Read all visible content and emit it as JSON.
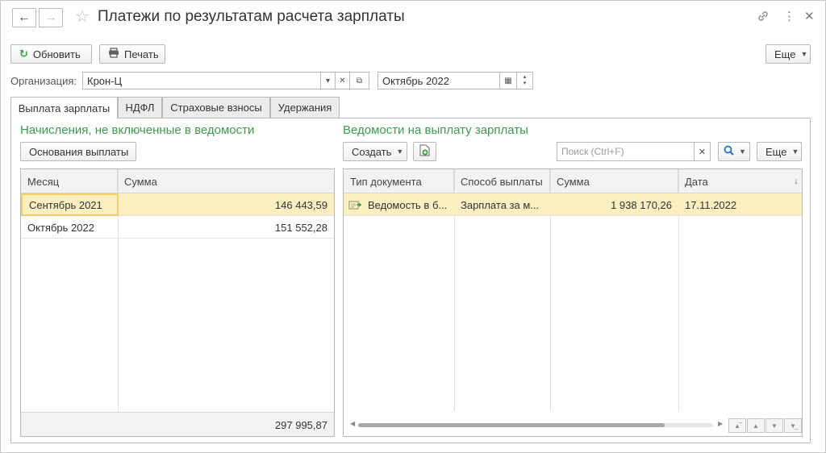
{
  "window": {
    "title": "Платежи по результатам расчета зарплаты",
    "icons": {
      "back": "arrow-left-icon",
      "forward": "arrow-right-icon",
      "favorite": "star-icon",
      "link": "link-icon",
      "more": "more-vertical-icon",
      "close": "close-icon"
    }
  },
  "toolbar": {
    "refresh_label": "Обновить",
    "print_label": "Печать",
    "more_label": "Еще"
  },
  "org": {
    "label": "Организация:",
    "value": "Крон-Ц",
    "period": "Октябрь 2022"
  },
  "tabs": [
    {
      "label": "Выплата зарплаты",
      "active": true
    },
    {
      "label": "НДФЛ",
      "active": false
    },
    {
      "label": "Страховые взносы",
      "active": false
    },
    {
      "label": "Удержания",
      "active": false
    }
  ],
  "left": {
    "title": "Начисления, не включенные в ведомости",
    "basis_button": "Основания выплаты",
    "columns": [
      "Месяц",
      "Сумма"
    ],
    "rows": [
      {
        "month": "Сентябрь 2021",
        "sum": "146 443,59"
      },
      {
        "month": "Октябрь 2022",
        "sum": "151 552,28"
      }
    ],
    "total": "297 995,87"
  },
  "right": {
    "title": "Ведомости на выплату зарплаты",
    "create_label": "Создать",
    "search_placeholder": "Поиск (Ctrl+F)",
    "more_label": "Еще",
    "columns": [
      "Тип документа",
      "Способ выплаты",
      "Сумма",
      "Дата"
    ],
    "rows": [
      {
        "type": "Ведомость в б...",
        "method": "Зарплата за м...",
        "sum": "1 938 170,26",
        "date": "17.11.2022"
      }
    ]
  },
  "colors": {
    "accent_green": "#3d9a4a",
    "selection": "#fbeec0",
    "focus_border": "#f0cf6e"
  }
}
